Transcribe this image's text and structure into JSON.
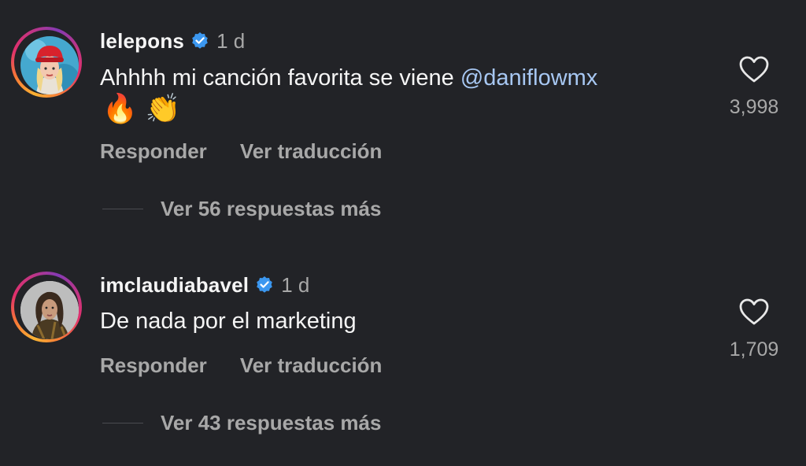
{
  "comments": [
    {
      "username": "lelepons",
      "time": "1 d",
      "text": "Ahhhh mi canción favorita se viene ",
      "mention": "@daniflowmx",
      "emojis": [
        "🔥",
        "👏"
      ],
      "reply_label": "Responder",
      "translate_label": "Ver traducción",
      "view_replies": "Ver 56 respuestas más",
      "likes": "3,998"
    },
    {
      "username": "imclaudiabavel",
      "time": "1 d",
      "text": "De nada por el marketing",
      "reply_label": "Responder",
      "translate_label": "Ver traducción",
      "view_replies": "Ver 43 respuestas más",
      "likes": "1,709"
    }
  ],
  "colors": {
    "background": "#222327",
    "mention": "#a7c7f2",
    "verified": "#3b97f0",
    "secondary_text": "#a8a8a8"
  },
  "icons": {
    "verified": "verified-badge-icon",
    "like": "heart-outline-icon"
  }
}
